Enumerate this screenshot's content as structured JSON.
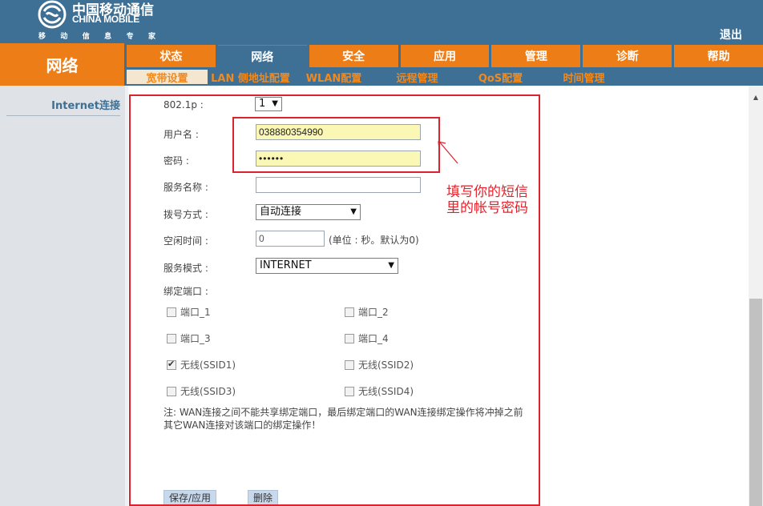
{
  "header": {
    "brand_cn": "中国移动通信",
    "brand_en": "CHINA MOBILE",
    "slogan": [
      "移",
      "动",
      "信",
      "息",
      "专",
      "家"
    ],
    "logout_label": "退出"
  },
  "nav": {
    "section_title": "网络",
    "main_tabs": [
      "状态",
      "网络",
      "安全",
      "应用",
      "管理",
      "诊断",
      "帮助"
    ],
    "active_main_tab": "网络",
    "sub_tabs": [
      "宽带设置",
      "LAN 侧地址配置",
      "WLAN配置",
      "远程管理",
      "QoS配置",
      "时间管理"
    ],
    "active_sub_tab": "宽带设置"
  },
  "sidebar": {
    "items": [
      "Internet连接"
    ]
  },
  "form": {
    "p8021_label": "802.1p :",
    "p8021_value": "1",
    "username_label": "用户名 :",
    "username_value": "038880354990",
    "password_label": "密码 :",
    "password_value": "••••••",
    "service_name_label": "服务名称 :",
    "service_name_value": "",
    "dial_mode_label": "拨号方式 :",
    "dial_mode_value": "自动连接",
    "idle_time_label": "空闲时间 :",
    "idle_time_value": "0",
    "idle_time_hint": "(单位 : 秒。默认为0)",
    "service_mode_label": "服务模式 :",
    "service_mode_value": "INTERNET",
    "bind_ports_label": "绑定端口 :",
    "ports": [
      {
        "label": "端口_1",
        "checked": false
      },
      {
        "label": "端口_2",
        "checked": false
      },
      {
        "label": "端口_3",
        "checked": false
      },
      {
        "label": "端口_4",
        "checked": false
      },
      {
        "label": "无线(SSID1)",
        "checked": true
      },
      {
        "label": "无线(SSID2)",
        "checked": false
      },
      {
        "label": "无线(SSID3)",
        "checked": false
      },
      {
        "label": "无线(SSID4)",
        "checked": false
      }
    ],
    "note": "注: WAN连接之间不能共享绑定端口，最后绑定端口的WAN连接绑定操作将冲掉之前其它WAN连接对该端口的绑定操作！",
    "save_label": "保存/应用",
    "delete_label": "删除"
  },
  "annotation": {
    "line1": "填写你的短信",
    "line2": "里的帐号密码",
    "color": "#e3222b"
  },
  "colors": {
    "header_blue": "#3e6f94",
    "accent_orange": "#ed7e17",
    "annotation_red": "#d9232d"
  }
}
